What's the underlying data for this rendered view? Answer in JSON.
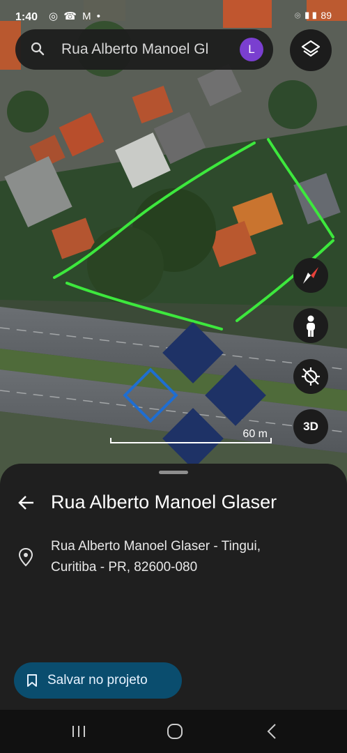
{
  "status_bar": {
    "time": "1:40",
    "app_icons": "◎ ☎ M •",
    "right_icons": "⌾ ▮▮ 89"
  },
  "search": {
    "query": "Rua Alberto Manoel Gl",
    "avatar_letter": "L"
  },
  "map": {
    "scale_label": "60 m",
    "colors": {
      "annotation": "#3de83d",
      "marker": "#1e3266",
      "marker_outline": "#1f6ed1"
    }
  },
  "controls": {
    "three_d_label": "3D"
  },
  "place": {
    "title": "Rua Alberto Manoel Glaser",
    "address_line1": "Rua Alberto Manoel Glaser - Tingui,",
    "address_line2": "Curitiba - PR, 82600-080"
  },
  "actions": {
    "save_label": "Salvar no projeto"
  }
}
